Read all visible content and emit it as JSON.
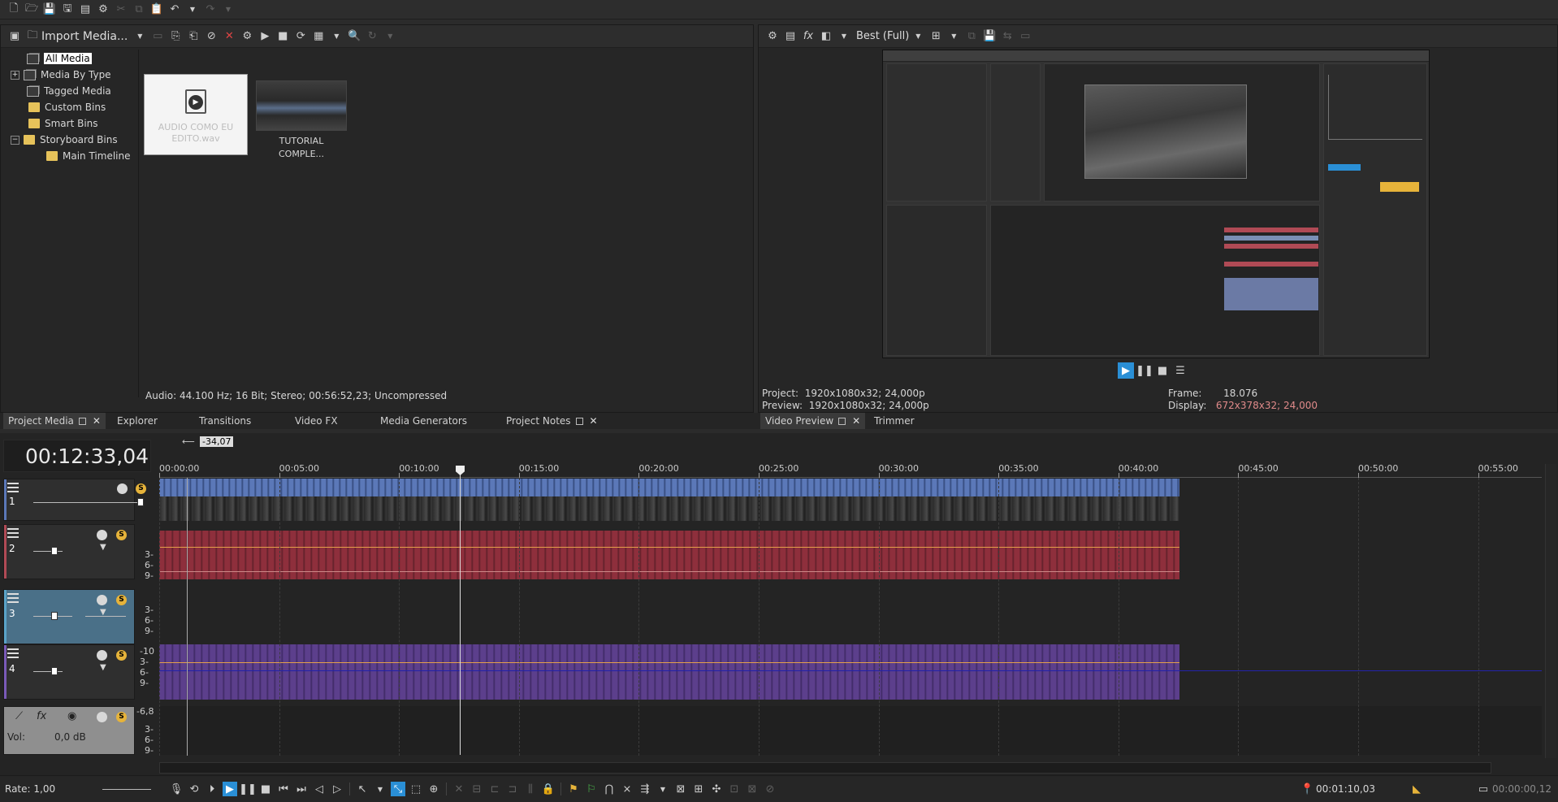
{
  "project_media": {
    "import_label": "Import Media...",
    "tree": [
      {
        "label": "All Media",
        "selected": true
      },
      {
        "label": "Media By Type",
        "expander": "+"
      },
      {
        "label": "Tagged Media"
      },
      {
        "label": "Custom Bins"
      },
      {
        "label": "Smart Bins"
      },
      {
        "label": "Storyboard Bins",
        "expander": "−"
      },
      {
        "label": "Main Timeline"
      }
    ],
    "thumbnails": [
      {
        "caption_line1": "AUDIO COMO EU",
        "caption_line2": "EDITO.wav"
      },
      {
        "caption_line1": "TUTORIAL",
        "caption_line2": "COMPLE..."
      }
    ],
    "status": "Audio: 44.100 Hz; 16 Bit; Stereo; 00:56:52,23; Uncompressed"
  },
  "tabs_left": [
    {
      "label": "Project Media",
      "active": true
    },
    {
      "label": "Explorer"
    },
    {
      "label": "Transitions"
    },
    {
      "label": "Video FX"
    },
    {
      "label": "Media Generators"
    },
    {
      "label": "Project Notes"
    }
  ],
  "video_preview": {
    "quality": "Best (Full)",
    "project_label": "Project:",
    "project_value": "1920x1080x32; 24,000p",
    "preview_label": "Preview:",
    "preview_value": "1920x1080x32; 24,000p",
    "frame_label": "Frame:",
    "frame_value": "18.076",
    "display_label": "Display:",
    "display_value": "672x378x32; 24,000"
  },
  "tabs_right": [
    {
      "label": "Video Preview",
      "active": true
    },
    {
      "label": "Trimmer"
    }
  ],
  "timeline": {
    "timecode": "00:12:33,04",
    "cursor_offset": "-34,07",
    "ruler": [
      "00:00:00",
      "00:05:00",
      "00:10:00",
      "00:15:00",
      "00:20:00",
      "00:25:00",
      "00:30:00",
      "00:35:00",
      "00:40:00",
      "00:45:00",
      "00:50:00",
      "00:55:00"
    ],
    "tracks": [
      {
        "num": "1",
        "type": "video"
      },
      {
        "num": "2",
        "type": "audio",
        "scale": [
          "3-",
          "6-",
          "9-"
        ]
      },
      {
        "num": "3",
        "type": "audio",
        "scale": [
          "3-",
          "6-",
          "9-"
        ]
      },
      {
        "num": "4",
        "type": "audio",
        "scale": [
          "-10",
          "3-",
          "6-",
          "9-"
        ]
      }
    ],
    "master": {
      "vol_label": "Vol:",
      "vol_value": "0,0 dB",
      "level": "-6,8",
      "scale": [
        "3-",
        "6-",
        "9-"
      ]
    },
    "rate": "Rate: 1,00",
    "time_position": "00:01:10,03",
    "time_length": "00:00:00,12"
  },
  "colors": {
    "video_track": "#5b78b8",
    "audio_track_red": "#8e2f3c",
    "audio_track_purple": "#5c3f8c",
    "display_value": "#e08a8a",
    "accent": "#2a8fd6"
  }
}
